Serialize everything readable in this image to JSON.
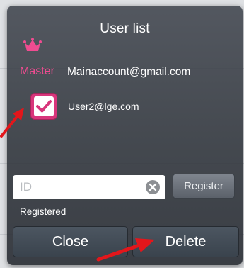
{
  "dialog": {
    "title": "User list",
    "master": {
      "label": "Master",
      "email": "Mainaccount@gmail.com",
      "icon": "crown-icon",
      "color": "#f04c91"
    },
    "users": [
      {
        "email": "User2@lge.com",
        "checked": true
      }
    ],
    "id_input": {
      "value": "",
      "placeholder": "ID"
    },
    "register_label": "Register",
    "registered_label": "Registered",
    "close_label": "Close",
    "delete_label": "Delete"
  },
  "colors": {
    "accent": "#d8357b",
    "annotation_arrow": "#e3161b"
  }
}
